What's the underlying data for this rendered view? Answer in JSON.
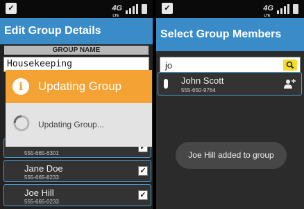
{
  "left": {
    "status": {
      "network": "4G",
      "network_sub": "LTE"
    },
    "title": "Edit Group Details",
    "group_name_label": "GROUP NAME",
    "group_name_value": "Housekeeping",
    "dialog": {
      "title": "Updating Group",
      "message": "Updating Group..."
    },
    "members": [
      {
        "name": "",
        "phone": "555-665-6301",
        "checked": true
      },
      {
        "name": "Jane Doe",
        "phone": "555-665-8233",
        "checked": true
      },
      {
        "name": "Joe Hill",
        "phone": "555-665-0233",
        "checked": true
      }
    ]
  },
  "right": {
    "status": {
      "network": "4G",
      "network_sub": "LTE"
    },
    "title": "Select Group Members",
    "search_value": "jo",
    "result": {
      "name": "John Scott",
      "phone": "555-650-9764"
    },
    "toast": "Joe Hill added to group"
  },
  "colors": {
    "title_bar": "#3a8cc9",
    "dialog_header": "#f4a233",
    "search_button": "#f4dc2a",
    "item_border": "#4a9fd2"
  }
}
